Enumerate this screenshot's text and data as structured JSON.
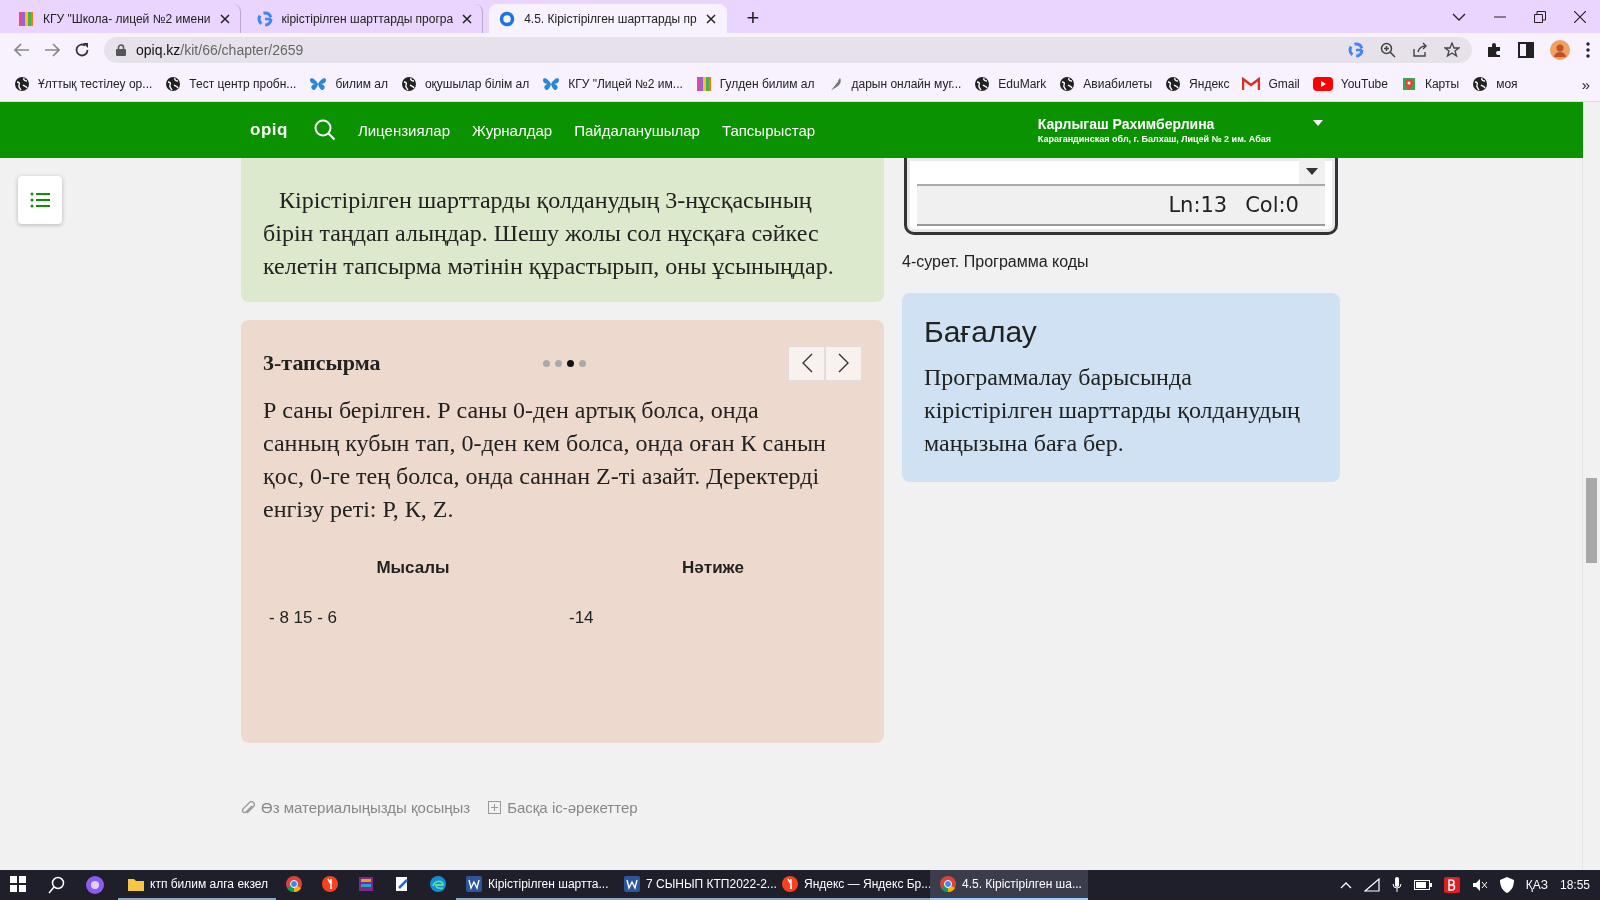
{
  "browser": {
    "tabs": [
      {
        "title": "КГУ \"Школа- лицей №2 имени",
        "kind": "stripes",
        "selected": false
      },
      {
        "title": "кірістірілген шарттарды програ",
        "kind": "google",
        "selected": false
      },
      {
        "title": "4.5. Кірістірілген шарттарды пр",
        "kind": "ring",
        "selected": true
      }
    ],
    "new_tab": "+",
    "url_host": "opiq.kz",
    "url_path": "/kit/66/chapter/2659",
    "bookmarks": [
      {
        "label": "Ұлттық тестілеу ор...",
        "kind": "globe"
      },
      {
        "label": "Тест центр пробн...",
        "kind": "globe"
      },
      {
        "label": "билим ал",
        "kind": "butterfly"
      },
      {
        "label": "оқушылар білім ал",
        "kind": "globe"
      },
      {
        "label": "КГУ \"Лицей №2 им...",
        "kind": "butterfly"
      },
      {
        "label": "Гулден билим ал",
        "kind": "stripes"
      },
      {
        "label": "дарын онлайн муг...",
        "kind": "feather"
      },
      {
        "label": "EduMark",
        "kind": "globe"
      },
      {
        "label": "Авиабилеты",
        "kind": "globe"
      },
      {
        "label": "Яндекс",
        "kind": "globe"
      },
      {
        "label": "Gmail",
        "kind": "mail"
      },
      {
        "label": "YouTube",
        "kind": "video"
      },
      {
        "label": "Карты",
        "kind": "map"
      },
      {
        "label": "моя",
        "kind": "globe"
      }
    ],
    "bookmarks_more": "»"
  },
  "site_nav": {
    "logo": "opiq",
    "menu": [
      "Лицензиялар",
      "Журналдар",
      "Пайдаланушылар",
      "Тапсырыстар"
    ],
    "user_name": "Карлыгаш Рахимберлина",
    "user_school": "Карагандинская обл, г. Балхаш, Лицей № 2 им. Абая"
  },
  "summary_card": {
    "text": "Кірістірілген шарттарды қолданудың 3-нұсқасының бірін таңдап алыңдар. Шешу жолы сол нұсқаға сәйкес келетін тапсырма мәтінін құрастырып, оны ұсыныңдар."
  },
  "task_card": {
    "title": "3-тапсырма",
    "dots": [
      {
        "selected": false
      },
      {
        "selected": false
      },
      {
        "selected": true
      },
      {
        "selected": false
      }
    ],
    "text": "Р саны берілген. Р саны 0-ден артық болса, онда санның кубын тап, 0-ден кем болса, онда оған К санын қос, 0-ге тең болса, онда саннан Z-ті азайт. Деректерді енгізу реті: Р, К, Z.",
    "columns": [
      "Мысалы",
      "Нәтиже"
    ],
    "rows": [
      [
        "- 8 15 - 6",
        "-14"
      ]
    ]
  },
  "figure": {
    "status_line": "Ln:13",
    "status_col": "Col:0",
    "caption": "4-сурет. Программа коды"
  },
  "assessment": {
    "title": "Бағалау",
    "text": "Программалау барысында кірістірілген шарттарды қолданудың маңызына баға бер."
  },
  "footer_links": [
    "Өз материалыңызды қосыңыз",
    "Басқа іс-әрекеттер"
  ],
  "taskbar": {
    "items": [
      {
        "kind": "folder",
        "label": "ктп билим алга екзел",
        "selected": false
      },
      {
        "kind": "chrome",
        "selected": false
      },
      {
        "kind": "yandex",
        "selected": false
      },
      {
        "kind": "archive",
        "selected": false
      },
      {
        "kind": "editor",
        "selected": false
      },
      {
        "kind": "edge",
        "selected": false
      },
      {
        "kind": "word",
        "label": "Кірістірілген шартта...",
        "selected": false
      },
      {
        "kind": "word",
        "label": "7 СЫНЫП КТП2022-2...",
        "selected": false
      },
      {
        "kind": "yandex",
        "label": "Яндекс — Яндекс Бр...",
        "selected": false
      },
      {
        "kind": "chrome",
        "label": "4.5. Кірістірілген ша...",
        "selected": true
      }
    ],
    "lang": "ҚАЗ",
    "time": "18:55"
  }
}
